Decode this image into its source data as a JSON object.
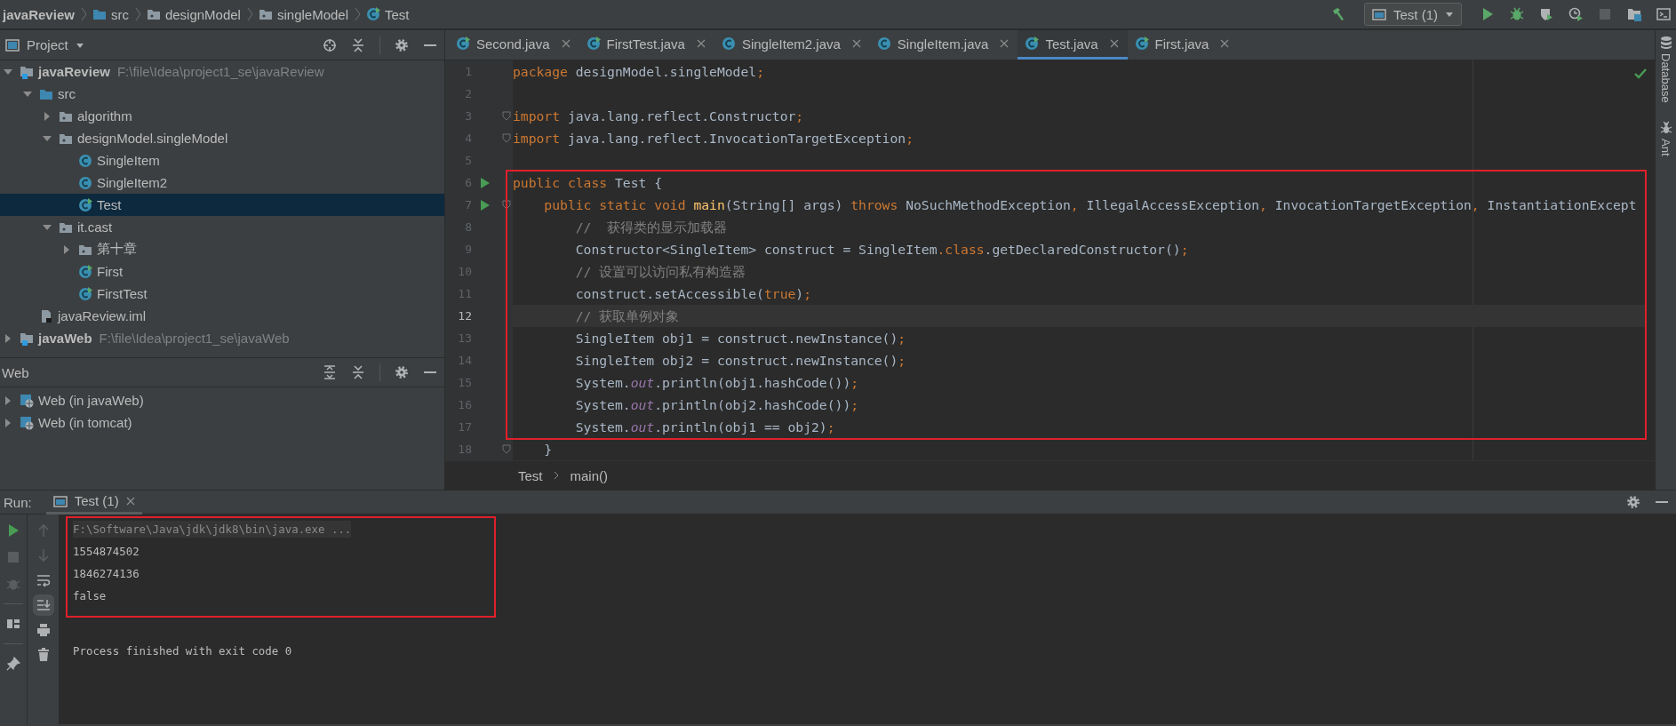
{
  "navigation": [
    {
      "label": "javaReview",
      "kind": "root"
    },
    {
      "label": "src",
      "kind": "folder"
    },
    {
      "label": "designModel",
      "kind": "package"
    },
    {
      "label": "singleModel",
      "kind": "package"
    },
    {
      "label": "Test",
      "kind": "runnable_class"
    }
  ],
  "run_toolbar": {
    "config": "Test (1)",
    "stop_enabled": false
  },
  "project_panel": {
    "title": "Project",
    "tree": [
      {
        "label": "javaReview",
        "path": "F:\\file\\Idea\\project1_se\\javaReview",
        "kind": "module",
        "expanded": true,
        "selected": false,
        "children": [
          {
            "label": "src",
            "kind": "folder",
            "expanded": true,
            "selected": false,
            "children": [
              {
                "label": "algorithm",
                "kind": "package",
                "expanded": false,
                "selected": false
              },
              {
                "label": "designModel.singleModel",
                "kind": "package",
                "expanded": true,
                "selected": false,
                "children": [
                  {
                    "label": "SingleItem",
                    "kind": "class",
                    "selected": false
                  },
                  {
                    "label": "SingleItem2",
                    "kind": "class",
                    "selected": false
                  },
                  {
                    "label": "Test",
                    "kind": "runnable_class",
                    "selected": true
                  }
                ]
              },
              {
                "label": "it.cast",
                "kind": "package",
                "expanded": true,
                "selected": false,
                "children": [
                  {
                    "label": "第十章",
                    "kind": "package",
                    "expanded": false,
                    "selected": false
                  },
                  {
                    "label": "First",
                    "kind": "runnable_class",
                    "selected": false
                  },
                  {
                    "label": "FirstTest",
                    "kind": "runnable_class",
                    "selected": false
                  }
                ]
              }
            ]
          },
          {
            "label": "javaReview.iml",
            "kind": "iml",
            "selected": false
          }
        ]
      },
      {
        "label": "javaWeb",
        "path": "F:\\file\\Idea\\project1_se\\javaWeb",
        "kind": "module",
        "expanded": false,
        "selected": false
      }
    ]
  },
  "web_panel": {
    "title": "Web",
    "items": [
      {
        "label": "Web (in javaWeb)",
        "kind": "web",
        "expanded": false,
        "selected": false
      },
      {
        "label": "Web (in tomcat)",
        "kind": "web",
        "expanded": false,
        "selected": false
      }
    ]
  },
  "editor": {
    "tabs": [
      {
        "label": "Second.java",
        "kind": "runnable_class",
        "selected": false
      },
      {
        "label": "FirstTest.java",
        "kind": "runnable_class",
        "selected": false
      },
      {
        "label": "SingleItem2.java",
        "kind": "class",
        "selected": false
      },
      {
        "label": "SingleItem.java",
        "kind": "class",
        "selected": false
      },
      {
        "label": "Test.java",
        "kind": "runnable_class",
        "selected": true
      },
      {
        "label": "First.java",
        "kind": "runnable_class",
        "selected": false
      }
    ],
    "lines": [
      {
        "number": "1",
        "current": false,
        "run_marker": false,
        "fold": false,
        "tokens": [
          {
            "kind": "kw",
            "text": "package"
          },
          {
            "kind": "plain",
            "text": " designModel.singleModel"
          },
          {
            "kind": "kw",
            "text": ";"
          }
        ]
      },
      {
        "number": "2",
        "current": false,
        "run_marker": false,
        "fold": false
      },
      {
        "number": "3",
        "current": false,
        "run_marker": false,
        "fold": true,
        "tokens": [
          {
            "kind": "kw",
            "text": "import"
          },
          {
            "kind": "plain",
            "text": " java.lang.reflect.Constructor"
          },
          {
            "kind": "kw",
            "text": ";"
          }
        ]
      },
      {
        "number": "4",
        "current": false,
        "run_marker": false,
        "fold": true,
        "tokens": [
          {
            "kind": "kw",
            "text": "import"
          },
          {
            "kind": "plain",
            "text": " java.lang.reflect.InvocationTargetException"
          },
          {
            "kind": "kw",
            "text": ";"
          }
        ]
      },
      {
        "number": "5",
        "current": false,
        "run_marker": false,
        "fold": false
      },
      {
        "kind": "frame",
        "lines": [
          {
            "number": "6",
            "current": false,
            "run_marker": true,
            "fold": false,
            "tokens": [
              {
                "kind": "kw",
                "text": "public class"
              },
              {
                "kind": "plain",
                "text": " Test {"
              }
            ]
          },
          {
            "number": "7",
            "current": false,
            "run_marker": true,
            "fold": true,
            "tokens": [
              {
                "kind": "kw",
                "text": "    public static void"
              },
              {
                "kind": "fn",
                "text": " main"
              },
              {
                "kind": "plain",
                "text": "(String[] args) "
              },
              {
                "kind": "kw",
                "text": "throws"
              },
              {
                "kind": "plain",
                "text": " NoSuchMethodException"
              },
              {
                "kind": "kw",
                "text": ","
              },
              {
                "kind": "plain",
                "text": " IllegalAccessException"
              },
              {
                "kind": "kw",
                "text": ","
              },
              {
                "kind": "plain",
                "text": " InvocationTargetException"
              },
              {
                "kind": "kw",
                "text": ","
              },
              {
                "kind": "plain",
                "text": " InstantiationExcept"
              }
            ]
          },
          {
            "number": "8",
            "current": false,
            "run_marker": false,
            "fold": false,
            "tokens": [
              {
                "kind": "comment",
                "text": "        //  获得类的显示加载器"
              }
            ]
          },
          {
            "number": "9",
            "current": false,
            "run_marker": false,
            "fold": false,
            "tokens": [
              {
                "kind": "plain",
                "text": "        Constructor<SingleItem> construct = SingleItem"
              },
              {
                "kind": "kw",
                "text": ".class"
              },
              {
                "kind": "plain",
                "text": ".getDeclaredConstructor()"
              },
              {
                "kind": "kw",
                "text": ";"
              }
            ]
          },
          {
            "number": "10",
            "current": false,
            "run_marker": false,
            "fold": false,
            "tokens": [
              {
                "kind": "comment",
                "text": "        // 设置可以访问私有构造器"
              }
            ]
          },
          {
            "number": "11",
            "current": false,
            "run_marker": false,
            "fold": false,
            "tokens": [
              {
                "kind": "plain",
                "text": "        construct.setAccessible("
              },
              {
                "kind": "kw",
                "text": "true"
              },
              {
                "kind": "plain",
                "text": ")"
              },
              {
                "kind": "kw",
                "text": ";"
              }
            ]
          },
          {
            "number": "12",
            "current": true,
            "run_marker": false,
            "fold": false,
            "tokens": [
              {
                "kind": "comment",
                "text": "        // 获取单例对象"
              }
            ]
          },
          {
            "number": "13",
            "current": false,
            "run_marker": false,
            "fold": false,
            "tokens": [
              {
                "kind": "plain",
                "text": "        SingleItem obj1 = construct.newInstance()"
              },
              {
                "kind": "kw",
                "text": ";"
              }
            ]
          },
          {
            "number": "14",
            "current": false,
            "run_marker": false,
            "fold": false,
            "tokens": [
              {
                "kind": "plain",
                "text": "        SingleItem obj2 = construct.newInstance()"
              },
              {
                "kind": "kw",
                "text": ";"
              }
            ]
          },
          {
            "number": "15",
            "current": false,
            "run_marker": false,
            "fold": false,
            "tokens": [
              {
                "kind": "plain",
                "text": "        System."
              },
              {
                "kind": "field",
                "text": "out"
              },
              {
                "kind": "plain",
                "text": ".println(obj1.hashCode())"
              },
              {
                "kind": "kw",
                "text": ";"
              }
            ]
          },
          {
            "number": "16",
            "current": false,
            "run_marker": false,
            "fold": false,
            "tokens": [
              {
                "kind": "plain",
                "text": "        System."
              },
              {
                "kind": "field",
                "text": "out"
              },
              {
                "kind": "plain",
                "text": ".println(obj2.hashCode())"
              },
              {
                "kind": "kw",
                "text": ";"
              }
            ]
          },
          {
            "number": "17",
            "current": false,
            "run_marker": false,
            "fold": false,
            "tokens": [
              {
                "kind": "plain",
                "text": "        System."
              },
              {
                "kind": "field",
                "text": "out"
              },
              {
                "kind": "plain",
                "text": ".println(obj1 == obj2)"
              },
              {
                "kind": "kw",
                "text": ";"
              }
            ]
          }
        ]
      },
      {
        "number": "18",
        "current": false,
        "run_marker": false,
        "fold": true,
        "tokens": [
          {
            "kind": "plain",
            "text": "    }"
          }
        ]
      }
    ],
    "breadcrumb": [
      "Test",
      "main()"
    ]
  },
  "right_strip": [
    {
      "label": "Database",
      "kind": "database"
    },
    {
      "label": "Ant",
      "kind": "ant"
    }
  ],
  "run_panel": {
    "label": "Run:",
    "tab": {
      "label": "Test (1)",
      "selected": true
    },
    "toggles": {
      "soft_wrap": false,
      "scroll_to_end": true
    },
    "console": [
      {
        "kind": "frame",
        "lines": [
          {
            "kind": "command",
            "text": "F:\\Software\\Java\\jdk\\jdk8\\bin\\java.exe ..."
          },
          {
            "kind": "output",
            "text": "1554874502"
          },
          {
            "kind": "output",
            "text": "1846274136"
          },
          {
            "kind": "output",
            "text": "false"
          }
        ]
      },
      {
        "kind": "status",
        "text": "Process finished with exit code 0"
      }
    ]
  }
}
